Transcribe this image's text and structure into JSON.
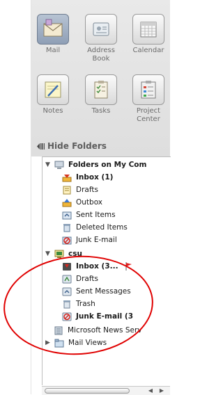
{
  "toolbar": {
    "buttons": [
      {
        "label": "Mail",
        "icon": "envelope-icon",
        "selected": true
      },
      {
        "label": "Address\nBook",
        "icon": "address-book-icon",
        "selected": false
      },
      {
        "label": "Calendar",
        "icon": "calendar-icon",
        "selected": false
      },
      {
        "label": "Notes",
        "icon": "notes-icon",
        "selected": false
      },
      {
        "label": "Tasks",
        "icon": "tasks-icon",
        "selected": false
      },
      {
        "label": "Project\nCenter",
        "icon": "project-center-icon",
        "selected": false
      }
    ],
    "hide_folders_label": "Hide Folders"
  },
  "folders": {
    "local_group": "Folders on My Com",
    "local_items": [
      {
        "label": "Inbox (1)",
        "icon": "inbox-icon",
        "bold": true
      },
      {
        "label": "Drafts",
        "icon": "drafts-icon",
        "bold": false
      },
      {
        "label": "Outbox",
        "icon": "outbox-icon",
        "bold": false
      },
      {
        "label": "Sent Items",
        "icon": "sent-items-icon",
        "bold": false
      },
      {
        "label": "Deleted Items",
        "icon": "deleted-items-icon",
        "bold": false
      },
      {
        "label": "Junk E-mail",
        "icon": "junk-mail-icon",
        "bold": false
      }
    ],
    "account_group": "csu",
    "account_items": [
      {
        "label": "Inbox (3...",
        "icon": "inbox-icon",
        "bold": true
      },
      {
        "label": "Drafts",
        "icon": "drafts-icon",
        "bold": false
      },
      {
        "label": "Sent Messages",
        "icon": "sent-messages-icon",
        "bold": false
      },
      {
        "label": "Trash",
        "icon": "trash-icon",
        "bold": false
      },
      {
        "label": "Junk E-mail (3",
        "icon": "junk-mail-icon",
        "bold": true
      }
    ],
    "news_server": "Microsoft News Serv",
    "mail_views": "Mail Views"
  },
  "colors": {
    "annotation": "#e00000",
    "selected_button": "#8f9fb6"
  }
}
